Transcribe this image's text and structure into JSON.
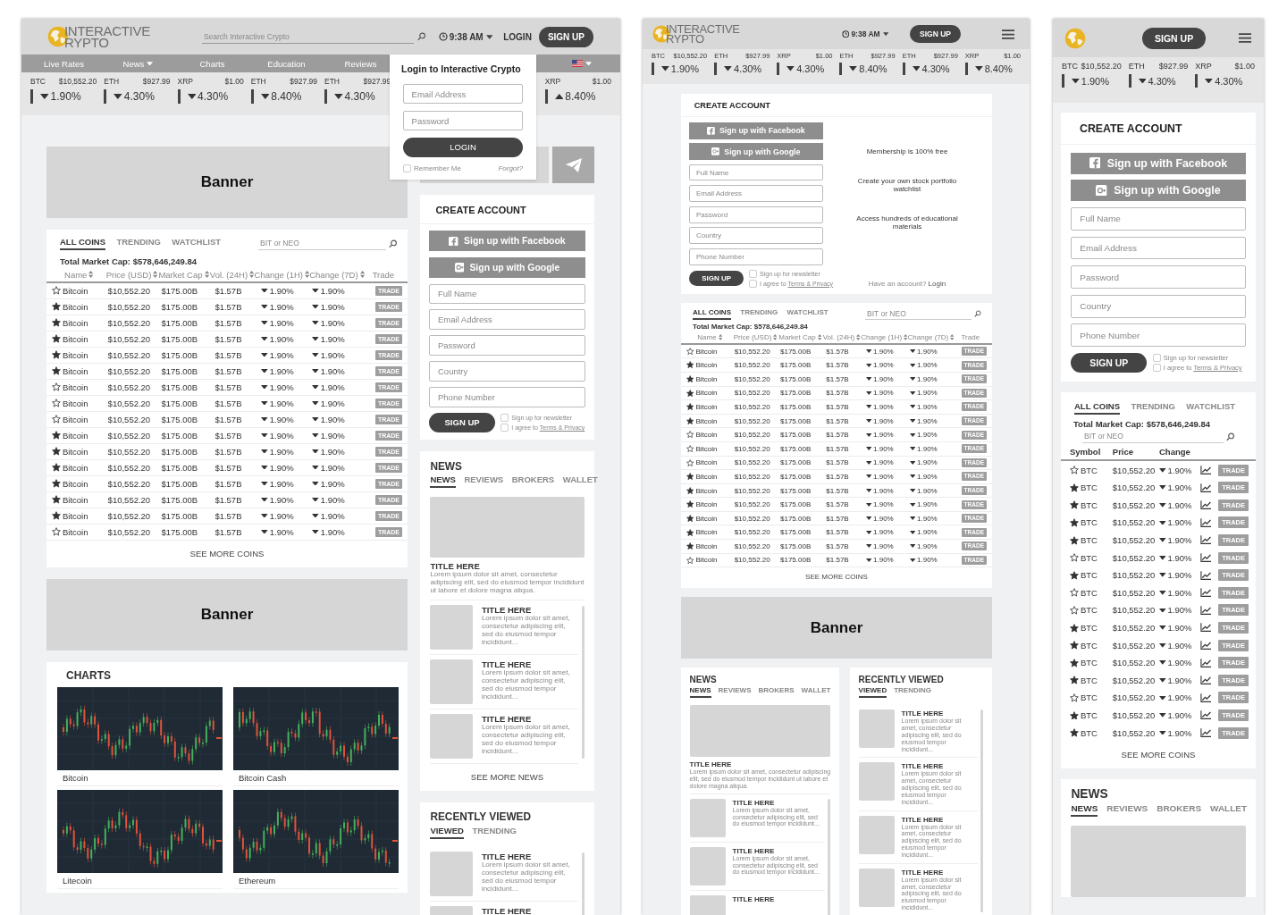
{
  "devices": [
    {
      "kind": "desktop",
      "header": {
        "logo": {
          "lines": [
            "INTERACTIVE",
            "RYPTO"
          ]
        },
        "search": {
          "placeholder": "Search Interactive Crypto"
        },
        "time": "9:38 AM",
        "login": "LOGIN",
        "signup": "SIGN UP"
      },
      "nav": [
        {
          "label": "Live Rates",
          "dropdown": false
        },
        {
          "label": "News",
          "dropdown": true
        },
        {
          "label": "Charts",
          "dropdown": false
        },
        {
          "label": "Education",
          "dropdown": false
        },
        {
          "label": "Reviews",
          "dropdown": false
        }
      ],
      "ticker": [
        {
          "symbol": "BTC",
          "price": "$10,552.20",
          "change": "1.90%",
          "rising": false
        },
        {
          "symbol": "ETH",
          "price": "$927.99",
          "change": "4.30%",
          "rising": false
        },
        {
          "symbol": "XRP",
          "price": "$1.00",
          "change": "4.30%",
          "rising": false
        },
        {
          "symbol": "ETH",
          "price": "$927.99",
          "change": "8.40%",
          "rising": false
        },
        {
          "symbol": "ETH",
          "price": "$927.99",
          "change": "4.30%",
          "rising": false
        },
        {
          "symbol": "XRP",
          "price": "$1.00",
          "change": "8.40%",
          "rising": true
        }
      ],
      "login_popup": {
        "title": "Login to Interactive Crypto",
        "fields": [
          {
            "placeholder": "Email Address"
          },
          {
            "placeholder": "Password"
          }
        ],
        "button": "LOGIN",
        "remember": {
          "label": "Remember Me",
          "checked": false
        },
        "forgot": "Forgot?"
      },
      "banners": [
        "Banner",
        "Banner"
      ],
      "coins": {
        "tabs": [
          {
            "label": "ALL COINS",
            "selected": true
          },
          {
            "label": "TRENDING",
            "selected": false
          },
          {
            "label": "WATCHLIST",
            "selected": false
          }
        ],
        "search": {
          "placeholder": "BIT or NEO"
        },
        "total": "Total Market Cap: $578,646,249.84",
        "columns": [
          {
            "label": "Name",
            "sortable": true
          },
          {
            "label": "Price (USD)",
            "sortable": true
          },
          {
            "label": "Market Cap",
            "sortable": true
          },
          {
            "label": "Vol. (24H)",
            "sortable": true
          },
          {
            "label": "Change (1H)",
            "sortable": true
          },
          {
            "label": "Change (7D)",
            "sortable": true
          },
          {
            "label": "Trade",
            "sortable": false
          }
        ],
        "rows": [
          {
            "starred": false,
            "name": "Bitcoin",
            "price": "$10,552.20",
            "market_cap": "$175.00B",
            "volume": "$1.57B",
            "change_1h": "1.90%",
            "change_7d": "1.90%",
            "rising": false,
            "action": "TRADE"
          },
          {
            "starred": true,
            "name": "Bitcoin",
            "price": "$10,552.20",
            "market_cap": "$175.00B",
            "volume": "$1.57B",
            "change_1h": "1.90%",
            "change_7d": "1.90%",
            "rising": false,
            "action": "TRADE"
          },
          {
            "starred": true,
            "name": "Bitcoin",
            "price": "$10,552.20",
            "market_cap": "$175.00B",
            "volume": "$1.57B",
            "change_1h": "1.90%",
            "change_7d": "1.90%",
            "rising": false,
            "action": "TRADE"
          },
          {
            "starred": true,
            "name": "Bitcoin",
            "price": "$10,552.20",
            "market_cap": "$175.00B",
            "volume": "$1.57B",
            "change_1h": "1.90%",
            "change_7d": "1.90%",
            "rising": false,
            "action": "TRADE"
          },
          {
            "starred": true,
            "name": "Bitcoin",
            "price": "$10,552.20",
            "market_cap": "$175.00B",
            "volume": "$1.57B",
            "change_1h": "1.90%",
            "change_7d": "1.90%",
            "rising": false,
            "action": "TRADE"
          },
          {
            "starred": true,
            "name": "Bitcoin",
            "price": "$10,552.20",
            "market_cap": "$175.00B",
            "volume": "$1.57B",
            "change_1h": "1.90%",
            "change_7d": "1.90%",
            "rising": false,
            "action": "TRADE"
          },
          {
            "starred": false,
            "name": "Bitcoin",
            "price": "$10,552.20",
            "market_cap": "$175.00B",
            "volume": "$1.57B",
            "change_1h": "1.90%",
            "change_7d": "1.90%",
            "rising": false,
            "action": "TRADE"
          },
          {
            "starred": false,
            "name": "Bitcoin",
            "price": "$10,552.20",
            "market_cap": "$175.00B",
            "volume": "$1.57B",
            "change_1h": "1.90%",
            "change_7d": "1.90%",
            "rising": false,
            "action": "TRADE"
          },
          {
            "starred": false,
            "name": "Bitcoin",
            "price": "$10,552.20",
            "market_cap": "$175.00B",
            "volume": "$1.57B",
            "change_1h": "1.90%",
            "change_7d": "1.90%",
            "rising": false,
            "action": "TRADE"
          },
          {
            "starred": true,
            "name": "Bitcoin",
            "price": "$10,552.20",
            "market_cap": "$175.00B",
            "volume": "$1.57B",
            "change_1h": "1.90%",
            "change_7d": "1.90%",
            "rising": false,
            "action": "TRADE"
          },
          {
            "starred": true,
            "name": "Bitcoin",
            "price": "$10,552.20",
            "market_cap": "$175.00B",
            "volume": "$1.57B",
            "change_1h": "1.90%",
            "change_7d": "1.90%",
            "rising": false,
            "action": "TRADE"
          },
          {
            "starred": true,
            "name": "Bitcoin",
            "price": "$10,552.20",
            "market_cap": "$175.00B",
            "volume": "$1.57B",
            "change_1h": "1.90%",
            "change_7d": "1.90%",
            "rising": false,
            "action": "TRADE"
          },
          {
            "starred": true,
            "name": "Bitcoin",
            "price": "$10,552.20",
            "market_cap": "$175.00B",
            "volume": "$1.57B",
            "change_1h": "1.90%",
            "change_7d": "1.90%",
            "rising": false,
            "action": "TRADE"
          },
          {
            "starred": true,
            "name": "Bitcoin",
            "price": "$10,552.20",
            "market_cap": "$175.00B",
            "volume": "$1.57B",
            "change_1h": "1.90%",
            "change_7d": "1.90%",
            "rising": false,
            "action": "TRADE"
          },
          {
            "starred": true,
            "name": "Bitcoin",
            "price": "$10,552.20",
            "market_cap": "$175.00B",
            "volume": "$1.57B",
            "change_1h": "1.90%",
            "change_7d": "1.90%",
            "rising": false,
            "action": "TRADE"
          },
          {
            "starred": false,
            "name": "Bitcoin",
            "price": "$10,552.20",
            "market_cap": "$175.00B",
            "volume": "$1.57B",
            "change_1h": "1.90%",
            "change_7d": "1.90%",
            "rising": false,
            "action": "TRADE"
          }
        ],
        "see_more": "SEE MORE COINS"
      },
      "charts": {
        "title": "CHARTS",
        "items": [
          {
            "name": "Bitcoin"
          },
          {
            "name": "Bitcoin Cash"
          },
          {
            "name": "Litecoin"
          },
          {
            "name": "Ethereum"
          }
        ]
      },
      "create_account": {
        "title": "CREATE ACCOUNT",
        "facebook": "Sign up with Facebook",
        "google": "Sign up with Google",
        "fields": [
          {
            "placeholder": "Full Name"
          },
          {
            "placeholder": "Email Address"
          },
          {
            "placeholder": "Password"
          },
          {
            "placeholder": "Country"
          },
          {
            "placeholder": "Phone Number"
          }
        ],
        "submit": "SIGN UP",
        "newsletter": {
          "label": "Sign up for newsletter",
          "checked": false
        },
        "agree": {
          "text": "I agree to",
          "link": "Terms & Privacy",
          "checked": false
        }
      },
      "news": {
        "title": "NEWS",
        "tabs": [
          {
            "label": "NEWS",
            "selected": true
          },
          {
            "label": "REVIEWS",
            "selected": false
          },
          {
            "label": "BROKERS",
            "selected": false
          },
          {
            "label": "WALLET",
            "selected": false
          }
        ],
        "featured": {
          "title": "TITLE HERE",
          "body": "Lorem ipsum dolor sit amet, consectetur adipiscing elit, sed do eiusmod tempor incididunt ut labore et dolore magna aliqua."
        },
        "items": [
          {
            "title": "TITLE HERE",
            "body": "Lorem ipsum dolor sit amet, consectetur adipiscing elit, sed do eiusmod tempor incididunt..."
          },
          {
            "title": "TITLE HERE",
            "body": "Lorem ipsum dolor sit amet, consectetur adipiscing elit, sed do eiusmod tempor incididunt..."
          },
          {
            "title": "TITLE HERE",
            "body": "Lorem ipsum dolor sit amet, consectetur adipiscing elit, sed do eiusmod tempor incididunt..."
          }
        ],
        "see_more": "SEE MORE NEWS"
      },
      "recently_viewed": {
        "title": "RECENTLY VIEWED",
        "tabs": [
          {
            "label": "VIEWED",
            "selected": true
          },
          {
            "label": "TRENDING",
            "selected": false
          }
        ],
        "items": [
          {
            "title": "TITLE HERE",
            "body": "Lorem ipsum dolor sit amet, consectetur adipiscing elit, sed do eiusmod tempor incididunt..."
          },
          {
            "title": "TITLE HERE"
          }
        ]
      }
    },
    {
      "kind": "tablet",
      "header": {
        "logo": {
          "lines": [
            "INTERACTIVE",
            "RYPTO"
          ]
        },
        "time": "9:38 AM",
        "signup": "SIGN UP"
      },
      "ticker": [
        {
          "symbol": "BTC",
          "price": "$10,552.20",
          "change": "1.90%",
          "rising": false
        },
        {
          "symbol": "ETH",
          "price": "$927.99",
          "change": "4.30%",
          "rising": false
        },
        {
          "symbol": "XRP",
          "price": "$1.00",
          "change": "4.30%",
          "rising": false
        },
        {
          "symbol": "ETH",
          "price": "$927.99",
          "change": "8.40%",
          "rising": false
        },
        {
          "symbol": "ETH",
          "price": "$927.99",
          "change": "4.30%",
          "rising": false
        },
        {
          "symbol": "XRP",
          "price": "$1.00",
          "change": "8.40%",
          "rising": false
        }
      ],
      "create_account": {
        "title": "CREATE ACCOUNT",
        "facebook": "Sign up with Facebook",
        "google": "Sign up with Google",
        "fields": [
          {
            "placeholder": "Full Name"
          },
          {
            "placeholder": "Email Address"
          },
          {
            "placeholder": "Password"
          },
          {
            "placeholder": "Country"
          },
          {
            "placeholder": "Phone Number"
          }
        ],
        "submit": "SIGN UP",
        "newsletter": {
          "label": "Sign up for newsletter",
          "checked": false
        },
        "agree": {
          "text": "I agree to",
          "link": "Terms & Privacy",
          "checked": false
        },
        "features": [
          "Membership is 100% free",
          "Create your own stock portfolio watchlist",
          "Access hundreds of educational materials"
        ],
        "login_prompt": {
          "text": "Have an account?",
          "link": "Login"
        }
      },
      "coins": {
        "tabs": [
          {
            "label": "ALL COINS",
            "selected": true
          },
          {
            "label": "TRENDING",
            "selected": false
          },
          {
            "label": "WATCHLIST",
            "selected": false
          }
        ],
        "search": {
          "placeholder": "BIT or NEO"
        },
        "total": "Total Market Cap: $578,646,249.84",
        "columns": [
          {
            "label": "Name",
            "sortable": true
          },
          {
            "label": "Price (USD)",
            "sortable": true
          },
          {
            "label": "Market Cap",
            "sortable": true
          },
          {
            "label": "Vol. (24H)",
            "sortable": true
          },
          {
            "label": "Change (1H)",
            "sortable": true
          },
          {
            "label": "Change (7D)",
            "sortable": true
          },
          {
            "label": "Trade",
            "sortable": false
          }
        ],
        "rows": [
          {
            "starred": false,
            "name": "Bitcoin",
            "price": "$10,552.20",
            "market_cap": "$175.00B",
            "volume": "$1.57B",
            "change_1h": "1.90%",
            "change_7d": "1.90%",
            "rising": false,
            "action": "TRADE"
          },
          {
            "starred": true,
            "name": "Bitcoin",
            "price": "$10,552.20",
            "market_cap": "$175.00B",
            "volume": "$1.57B",
            "change_1h": "1.90%",
            "change_7d": "1.90%",
            "rising": false,
            "action": "TRADE"
          },
          {
            "starred": true,
            "name": "Bitcoin",
            "price": "$10,552.20",
            "market_cap": "$175.00B",
            "volume": "$1.57B",
            "change_1h": "1.90%",
            "change_7d": "1.90%",
            "rising": false,
            "action": "TRADE"
          },
          {
            "starred": true,
            "name": "Bitcoin",
            "price": "$10,552.20",
            "market_cap": "$175.00B",
            "volume": "$1.57B",
            "change_1h": "1.90%",
            "change_7d": "1.90%",
            "rising": false,
            "action": "TRADE"
          },
          {
            "starred": true,
            "name": "Bitcoin",
            "price": "$10,552.20",
            "market_cap": "$175.00B",
            "volume": "$1.57B",
            "change_1h": "1.90%",
            "change_7d": "1.90%",
            "rising": false,
            "action": "TRADE"
          },
          {
            "starred": true,
            "name": "Bitcoin",
            "price": "$10,552.20",
            "market_cap": "$175.00B",
            "volume": "$1.57B",
            "change_1h": "1.90%",
            "change_7d": "1.90%",
            "rising": false,
            "action": "TRADE"
          },
          {
            "starred": false,
            "name": "Bitcoin",
            "price": "$10,552.20",
            "market_cap": "$175.00B",
            "volume": "$1.57B",
            "change_1h": "1.90%",
            "change_7d": "1.90%",
            "rising": false,
            "action": "TRADE"
          },
          {
            "starred": false,
            "name": "Bitcoin",
            "price": "$10,552.20",
            "market_cap": "$175.00B",
            "volume": "$1.57B",
            "change_1h": "1.90%",
            "change_7d": "1.90%",
            "rising": false,
            "action": "TRADE"
          },
          {
            "starred": false,
            "name": "Bitcoin",
            "price": "$10,552.20",
            "market_cap": "$175.00B",
            "volume": "$1.57B",
            "change_1h": "1.90%",
            "change_7d": "1.90%",
            "rising": false,
            "action": "TRADE"
          },
          {
            "starred": true,
            "name": "Bitcoin",
            "price": "$10,552.20",
            "market_cap": "$175.00B",
            "volume": "$1.57B",
            "change_1h": "1.90%",
            "change_7d": "1.90%",
            "rising": false,
            "action": "TRADE"
          },
          {
            "starred": true,
            "name": "Bitcoin",
            "price": "$10,552.20",
            "market_cap": "$175.00B",
            "volume": "$1.57B",
            "change_1h": "1.90%",
            "change_7d": "1.90%",
            "rising": false,
            "action": "TRADE"
          },
          {
            "starred": true,
            "name": "Bitcoin",
            "price": "$10,552.20",
            "market_cap": "$175.00B",
            "volume": "$1.57B",
            "change_1h": "1.90%",
            "change_7d": "1.90%",
            "rising": false,
            "action": "TRADE"
          },
          {
            "starred": true,
            "name": "Bitcoin",
            "price": "$10,552.20",
            "market_cap": "$175.00B",
            "volume": "$1.57B",
            "change_1h": "1.90%",
            "change_7d": "1.90%",
            "rising": false,
            "action": "TRADE"
          },
          {
            "starred": true,
            "name": "Bitcoin",
            "price": "$10,552.20",
            "market_cap": "$175.00B",
            "volume": "$1.57B",
            "change_1h": "1.90%",
            "change_7d": "1.90%",
            "rising": false,
            "action": "TRADE"
          },
          {
            "starred": true,
            "name": "Bitcoin",
            "price": "$10,552.20",
            "market_cap": "$175.00B",
            "volume": "$1.57B",
            "change_1h": "1.90%",
            "change_7d": "1.90%",
            "rising": false,
            "action": "TRADE"
          },
          {
            "starred": false,
            "name": "Bitcoin",
            "price": "$10,552.20",
            "market_cap": "$175.00B",
            "volume": "$1.57B",
            "change_1h": "1.90%",
            "change_7d": "1.90%",
            "rising": false,
            "action": "TRADE"
          }
        ],
        "see_more": "SEE MORE COINS"
      },
      "banners": [
        "Banner"
      ],
      "news": {
        "title": "NEWS",
        "tabs": [
          {
            "label": "NEWS",
            "selected": true
          },
          {
            "label": "REVIEWS",
            "selected": false
          },
          {
            "label": "BROKERS",
            "selected": false
          },
          {
            "label": "WALLET",
            "selected": false
          }
        ],
        "featured": {
          "title": "TITLE HERE",
          "body": "Lorem ipsum dolor sit amet, consectetur adipiscing elit, sed do eiusmod tempor incididunt ut labore et dolore magna aliqua."
        },
        "items": [
          {
            "title": "TITLE HERE",
            "body": "Lorem ipsum dolor sit amet, consectetur adipiscing elit, sed do eiusmod tempor incididunt..."
          },
          {
            "title": "TITLE HERE",
            "body": "Lorem ipsum dolor sit amet, consectetur adipiscing elit, sed do eiusmod tempor incididunt..."
          },
          {
            "title": "TITLE HERE"
          }
        ]
      },
      "recently_viewed": {
        "title": "RECENTLY VIEWED",
        "tabs": [
          {
            "label": "VIEWED",
            "selected": true
          },
          {
            "label": "TRENDING",
            "selected": false
          }
        ],
        "items": [
          {
            "title": "TITLE HERE",
            "body": "Lorem ipsum dolor sit amet, consectetur adipiscing elit, sed do eiusmod tempor incididunt..."
          },
          {
            "title": "TITLE HERE",
            "body": "Lorem ipsum dolor sit amet, consectetur adipiscing elit, sed do eiusmod tempor incididunt..."
          },
          {
            "title": "TITLE HERE",
            "body": "Lorem ipsum dolor sit amet, consectetur adipiscing elit, sed do eiusmod tempor incididunt..."
          },
          {
            "title": "TITLE HERE",
            "body": "Lorem ipsum dolor sit amet, consectetur adipiscing elit, sed do eiusmod tempor incididunt..."
          }
        ]
      }
    },
    {
      "kind": "mobile",
      "header": {
        "signup": "SIGN UP"
      },
      "ticker": [
        {
          "symbol": "BTC",
          "price": "$10,552.20",
          "change": "1.90%",
          "rising": false
        },
        {
          "symbol": "ETH",
          "price": "$927.99",
          "change": "4.30%",
          "rising": false
        },
        {
          "symbol": "XRP",
          "price": "$1.00",
          "change": "4.30%",
          "rising": false
        }
      ],
      "create_account": {
        "title": "CREATE ACCOUNT",
        "facebook": "Sign up with Facebook",
        "google": "Sign up with Google",
        "fields": [
          {
            "placeholder": "Full Name"
          },
          {
            "placeholder": "Email Address"
          },
          {
            "placeholder": "Password"
          },
          {
            "placeholder": "Country"
          },
          {
            "placeholder": "Phone Number"
          }
        ],
        "submit": "SIGN UP",
        "newsletter": {
          "label": "Sign up for newsletter",
          "checked": false
        },
        "agree": {
          "text": "I agree to",
          "link": "Terms & Privacy",
          "checked": false
        }
      },
      "coins": {
        "tabs": [
          {
            "label": "ALL COINS",
            "selected": true
          },
          {
            "label": "TRENDING",
            "selected": false
          },
          {
            "label": "WATCHLIST",
            "selected": false
          }
        ],
        "total": "Total Market Cap: $578,646,249.84",
        "search": {
          "placeholder": "BIT or NEO"
        },
        "columns": [
          {
            "label": "Symbol",
            "sortable": false
          },
          {
            "label": "Price",
            "sortable": false
          },
          {
            "label": "Change",
            "sortable": false
          }
        ],
        "rows": [
          {
            "starred": false,
            "symbol": "BTC",
            "price": "$10,552.20",
            "change": "1.90%",
            "rising": false,
            "action": "TRADE"
          },
          {
            "starred": true,
            "symbol": "BTC",
            "price": "$10,552.20",
            "change": "1.90%",
            "rising": false,
            "action": "TRADE"
          },
          {
            "starred": true,
            "symbol": "BTC",
            "price": "$10,552.20",
            "change": "1.90%",
            "rising": false,
            "action": "TRADE"
          },
          {
            "starred": true,
            "symbol": "BTC",
            "price": "$10,552.20",
            "change": "1.90%",
            "rising": false,
            "action": "TRADE"
          },
          {
            "starred": true,
            "symbol": "BTC",
            "price": "$10,552.20",
            "change": "1.90%",
            "rising": false,
            "action": "TRADE"
          },
          {
            "starred": false,
            "symbol": "BTC",
            "price": "$10,552.20",
            "change": "1.90%",
            "rising": false,
            "action": "TRADE"
          },
          {
            "starred": true,
            "symbol": "BTC",
            "price": "$10,552.20",
            "change": "1.90%",
            "rising": false,
            "action": "TRADE"
          },
          {
            "starred": false,
            "symbol": "BTC",
            "price": "$10,552.20",
            "change": "1.90%",
            "rising": false,
            "action": "TRADE"
          },
          {
            "starred": false,
            "symbol": "BTC",
            "price": "$10,552.20",
            "change": "1.90%",
            "rising": false,
            "action": "TRADE"
          },
          {
            "starred": true,
            "symbol": "BTC",
            "price": "$10,552.20",
            "change": "1.90%",
            "rising": false,
            "action": "TRADE"
          },
          {
            "starred": true,
            "symbol": "BTC",
            "price": "$10,552.20",
            "change": "1.90%",
            "rising": false,
            "action": "TRADE"
          },
          {
            "starred": true,
            "symbol": "BTC",
            "price": "$10,552.20",
            "change": "1.90%",
            "rising": false,
            "action": "TRADE"
          },
          {
            "starred": true,
            "symbol": "BTC",
            "price": "$10,552.20",
            "change": "1.90%",
            "rising": false,
            "action": "TRADE"
          },
          {
            "starred": false,
            "symbol": "BTC",
            "price": "$10,552.20",
            "change": "1.90%",
            "rising": false,
            "action": "TRADE"
          },
          {
            "starred": true,
            "symbol": "BTC",
            "price": "$10,552.20",
            "change": "1.90%",
            "rising": false,
            "action": "TRADE"
          },
          {
            "starred": true,
            "symbol": "BTC",
            "price": "$10,552.20",
            "change": "1.90%",
            "rising": false,
            "action": "TRADE"
          }
        ],
        "see_more": "SEE MORE COINS"
      },
      "news": {
        "title": "NEWS",
        "tabs": [
          {
            "label": "NEWS",
            "selected": true
          },
          {
            "label": "REVIEWS",
            "selected": false
          },
          {
            "label": "BROKERS",
            "selected": false
          },
          {
            "label": "WALLET",
            "selected": false
          }
        ]
      }
    }
  ]
}
